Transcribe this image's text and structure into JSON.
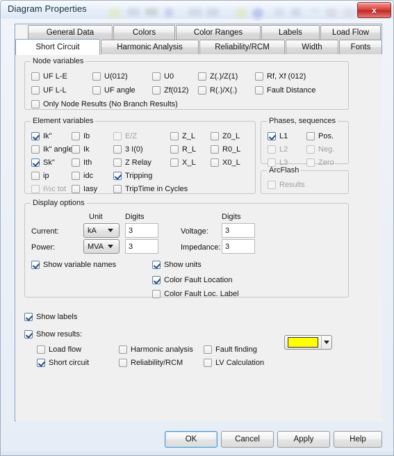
{
  "window": {
    "title": "Diagram Properties",
    "close_label": "x",
    "close_icon": "close-icon"
  },
  "tabs": {
    "row1": [
      {
        "label": "General Data",
        "active": false
      },
      {
        "label": "Colors",
        "active": false
      },
      {
        "label": "Color Ranges",
        "active": false
      },
      {
        "label": "Labels",
        "active": false
      },
      {
        "label": "Load Flow",
        "active": false
      }
    ],
    "row2": [
      {
        "label": "Short Circuit",
        "active": true
      },
      {
        "label": "Harmonic Analysis",
        "active": false
      },
      {
        "label": "Reliability/RCM",
        "active": false
      },
      {
        "label": "Width",
        "active": false
      },
      {
        "label": "Fonts",
        "active": false
      }
    ]
  },
  "node_variables": {
    "title": "Node variables",
    "items": [
      {
        "label": "UF L-E",
        "checked": false,
        "disabled": false
      },
      {
        "label": "U(012)",
        "checked": false,
        "disabled": false
      },
      {
        "label": "U0",
        "checked": false,
        "disabled": false
      },
      {
        "label": "Z(.)/Z(1)",
        "checked": false,
        "disabled": false
      },
      {
        "label": "Rf, Xf (012)",
        "checked": false,
        "disabled": false
      },
      {
        "label": "UF L-L",
        "checked": false,
        "disabled": false
      },
      {
        "label": "UF angle",
        "checked": false,
        "disabled": false
      },
      {
        "label": "Zf(012)",
        "checked": false,
        "disabled": false
      },
      {
        "label": "R(.)/X(.)",
        "checked": false,
        "disabled": false
      },
      {
        "label": "Fault Distance",
        "checked": false,
        "disabled": false
      },
      {
        "label": "Only Node Results (No Branch Results)",
        "checked": false,
        "disabled": false
      }
    ]
  },
  "element_variables": {
    "title": "Element variables",
    "items": [
      {
        "label": "Ik\"",
        "checked": true,
        "disabled": false
      },
      {
        "label": "Ik\" angle",
        "checked": false,
        "disabled": false
      },
      {
        "label": "Sk\"",
        "checked": true,
        "disabled": false
      },
      {
        "label": "ip",
        "checked": false,
        "disabled": false
      },
      {
        "label": "I½c tot",
        "checked": false,
        "disabled": true
      },
      {
        "label": "Ib",
        "checked": false,
        "disabled": false
      },
      {
        "label": "Ik",
        "checked": false,
        "disabled": false
      },
      {
        "label": "Ith",
        "checked": false,
        "disabled": false
      },
      {
        "label": "idc",
        "checked": false,
        "disabled": false
      },
      {
        "label": "Iasy",
        "checked": false,
        "disabled": false
      },
      {
        "label": "E/Z",
        "checked": false,
        "disabled": true
      },
      {
        "label": "3 I(0)",
        "checked": false,
        "disabled": false
      },
      {
        "label": "Z Relay",
        "checked": false,
        "disabled": false
      },
      {
        "label": "Tripping",
        "checked": true,
        "disabled": false
      },
      {
        "label": "TripTime in Cycles",
        "checked": false,
        "disabled": false
      },
      {
        "label": "Z_L",
        "checked": false,
        "disabled": false
      },
      {
        "label": "R_L",
        "checked": false,
        "disabled": false
      },
      {
        "label": "X_L",
        "checked": false,
        "disabled": false
      },
      {
        "label": "Z0_L",
        "checked": false,
        "disabled": false
      },
      {
        "label": "R0_L",
        "checked": false,
        "disabled": false
      },
      {
        "label": "X0_L",
        "checked": false,
        "disabled": false
      }
    ]
  },
  "phases": {
    "title": "Phases, sequences",
    "items": [
      {
        "label": "L1",
        "checked": true,
        "disabled": false
      },
      {
        "label": "L2",
        "checked": false,
        "disabled": true
      },
      {
        "label": "L3",
        "checked": false,
        "disabled": true
      },
      {
        "label": "Pos.",
        "checked": false,
        "disabled": false
      },
      {
        "label": "Neg.",
        "checked": false,
        "disabled": true
      },
      {
        "label": "Zero",
        "checked": false,
        "disabled": true
      }
    ]
  },
  "arcflash": {
    "title": "ArcFlash",
    "items": [
      {
        "label": "Results",
        "checked": false,
        "disabled": true
      }
    ]
  },
  "display_options": {
    "title": "Display options",
    "col_unit": "Unit",
    "col_digits_left": "Digits",
    "col_digits_right": "Digits",
    "current_label": "Current:",
    "current_unit": "kA",
    "current_digits": "3",
    "power_label": "Power:",
    "power_unit": "MVA",
    "power_digits": "3",
    "voltage_label": "Voltage:",
    "voltage_digits": "3",
    "impedance_label": "Impedance:",
    "impedance_digits": "3",
    "checks": [
      {
        "label": "Show variable names",
        "checked": true,
        "disabled": false
      },
      {
        "label": "Show units",
        "checked": true,
        "disabled": false
      },
      {
        "label": "Color Fault Location",
        "checked": true,
        "disabled": false
      },
      {
        "label": "Color Fault Loc. Label",
        "checked": false,
        "disabled": false
      }
    ],
    "fault_color": "#ffff00"
  },
  "bottom": {
    "show_labels": {
      "label": "Show labels",
      "checked": true
    },
    "show_results": {
      "label": "Show results:",
      "checked": true
    },
    "results": [
      {
        "label": "Load flow",
        "checked": false
      },
      {
        "label": "Harmonic analysis",
        "checked": false
      },
      {
        "label": "Fault finding",
        "checked": false
      },
      {
        "label": "Short circuit",
        "checked": true
      },
      {
        "label": "Reliability/RCM",
        "checked": false
      },
      {
        "label": "LV Calculation",
        "checked": false
      }
    ]
  },
  "buttons": [
    {
      "label": "OK",
      "default": true
    },
    {
      "label": "Cancel",
      "default": false
    },
    {
      "label": "Apply",
      "default": false
    },
    {
      "label": "Help",
      "default": false
    }
  ]
}
